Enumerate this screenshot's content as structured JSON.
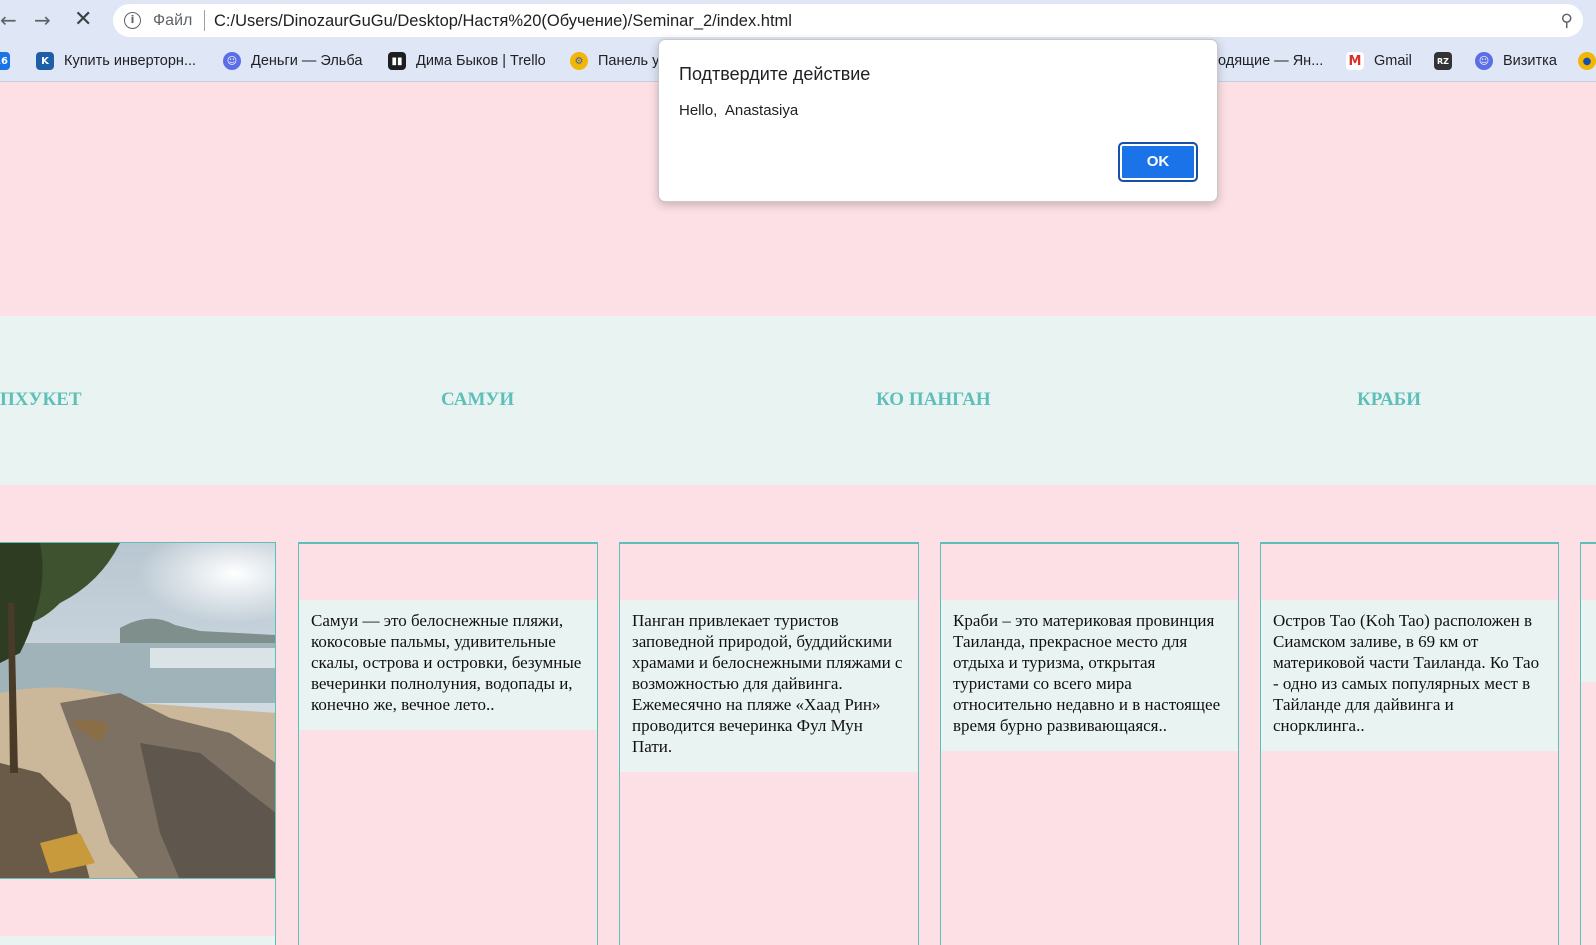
{
  "browser": {
    "scheme_label": "Файл",
    "url": "C:/Users/DinozaurGuGu/Desktop/Настя%20(Обучение)/Seminar_2/index.html",
    "bookmarks": [
      {
        "label": "Купить инверторн...",
        "icon": "k-icon",
        "color": "#1f5fa8",
        "glyph": "K"
      },
      {
        "label": "Деньги — Эльба",
        "icon": "elba-icon",
        "color": "#5b6ee6",
        "glyph": "☺"
      },
      {
        "label": "Дима Быков | Trello",
        "icon": "trello-icon",
        "color": "#1e1e1e",
        "glyph": "▮▮"
      },
      {
        "label": "Панель у",
        "icon": "panel-icon",
        "color": "#f2b705",
        "glyph": "⚙"
      },
      {
        "label": "одящие — Ян...",
        "icon": "yandex-mail-icon",
        "color": "#ffffff",
        "glyph": ""
      },
      {
        "label": "Gmail",
        "icon": "gmail-icon",
        "color": "#ffffff",
        "glyph": "M"
      },
      {
        "label": "",
        "icon": "irz-icon",
        "color": "#333333",
        "glyph": "RZ"
      },
      {
        "label": "Визитка",
        "icon": "vizitka-icon",
        "color": "#5b6ee6",
        "glyph": "☺"
      }
    ]
  },
  "dialog": {
    "title": "Подтвердите действие",
    "message": "Hello,  Anastasiya",
    "ok_label": "OK"
  },
  "islands": [
    "ПХУКЕТ",
    "САМУИ",
    "КО ПАНГАН",
    "КРАБИ"
  ],
  "cards": [
    {
      "text": "Самуи — это белоснежные пляжи, кокосовые пальмы, удивительные скалы, острова и островки, безумные вечеринки полнолуния, водопады и, конечно же, вечное лето.."
    },
    {
      "text": "Панган привлекает туристов заповедной природой, буддийскими храмами и белоснежными пляжами с возможностью для дайвинга. Ежемесячно на пляже «Хаад Рин» проводится вечеринка Фул Мун Пати."
    },
    {
      "text": "Краби – это материковая провинция Таиланда, прекрасное место для отдыха и туризма, открытая туристами со всего мира относительно недавно и в настоящее время бурно развивающаяся.."
    },
    {
      "text": "Остров Тао (Koh Tao) расположен в Сиамском заливе, в 69 км от материковой части Таиланда. Ко Тао - одно из самых популярных мест в Тайланде для дайвинга и снорклинга.."
    },
    {
      "text": ""
    }
  ],
  "colors": {
    "page_bg": "#fde0e5",
    "band_bg": "#e9f4f2",
    "accent": "#5ebfb9",
    "ok_button": "#1a73e8"
  }
}
